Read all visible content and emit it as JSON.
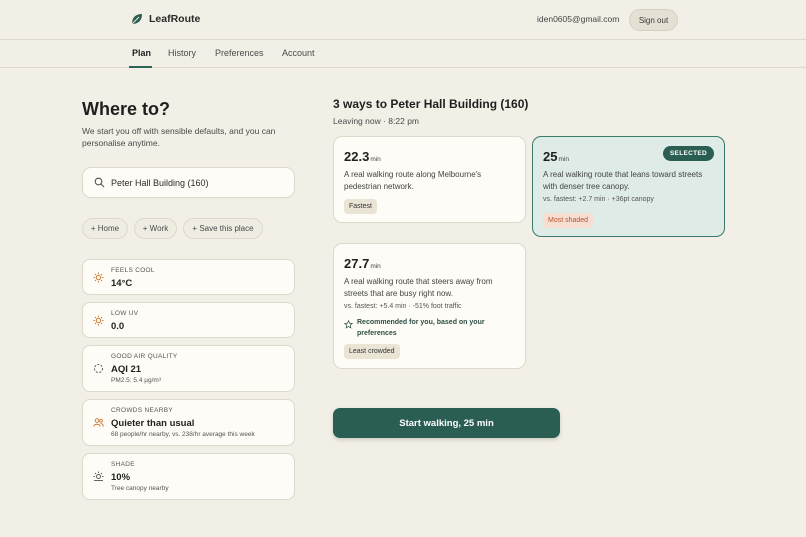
{
  "header": {
    "brand": "LeafRoute",
    "email": "iden0605@gmail.com",
    "sign_out": "Sign out"
  },
  "tabs": [
    "Plan",
    "History",
    "Preferences",
    "Account"
  ],
  "active_tab": "Plan",
  "planner": {
    "title": "Where to?",
    "intro": "We start you off with sensible defaults, and you can personalise anytime.",
    "search_value": "Peter Hall Building (160)",
    "chips": [
      "+ Home",
      "+ Work",
      "+ Save this place"
    ]
  },
  "conditions": [
    {
      "label": "FEELS COOL",
      "value": "14°C",
      "sub": "",
      "icon": "sun-icon"
    },
    {
      "label": "LOW UV",
      "value": "0.0",
      "sub": "",
      "icon": "sun-icon"
    },
    {
      "label": "GOOD AIR QUALITY",
      "value": "AQI 21",
      "sub": "PM2.5: 5.4 µg/m³",
      "icon": "air-icon"
    },
    {
      "label": "CROWDS NEARBY",
      "value": "Quieter than usual",
      "sub": "68 people/hr nearby, vs. 238/hr average this week",
      "icon": "people-icon"
    },
    {
      "label": "SHADE",
      "value": "10%",
      "sub": "Tree canopy nearby",
      "icon": "shade-icon"
    }
  ],
  "routes_header": {
    "title": "3 ways to Peter Hall Building (160)",
    "leaving": "Leaving now · 8:22 pm"
  },
  "routes": [
    {
      "time": "22.3",
      "unit": "min",
      "desc": "A real walking route along Melbourne's pedestrian network.",
      "compare": "",
      "tag": "Fastest",
      "selected": false
    },
    {
      "time": "25",
      "unit": "min",
      "desc": "A real walking route that leans toward streets with denser tree canopy.",
      "compare": "vs. fastest: +2.7 min · +36pt canopy",
      "tag": "Most shaded",
      "selected": true,
      "badge": "SELECTED"
    },
    {
      "time": "27.7",
      "unit": "min",
      "desc": "A real walking route that steers away from streets that are busy right now.",
      "compare": "vs. fastest: +5.4 min · -51% foot traffic",
      "recommendation": "Recommended for you, based on your preferences",
      "tag": "Least crowded",
      "selected": false
    }
  ],
  "start_button": "Start walking, 25 min",
  "colors": {
    "accent": "#2a5e52",
    "background": "#f2efe6",
    "selected_card": "#deebe6",
    "shade_tag": "#b5532e"
  }
}
